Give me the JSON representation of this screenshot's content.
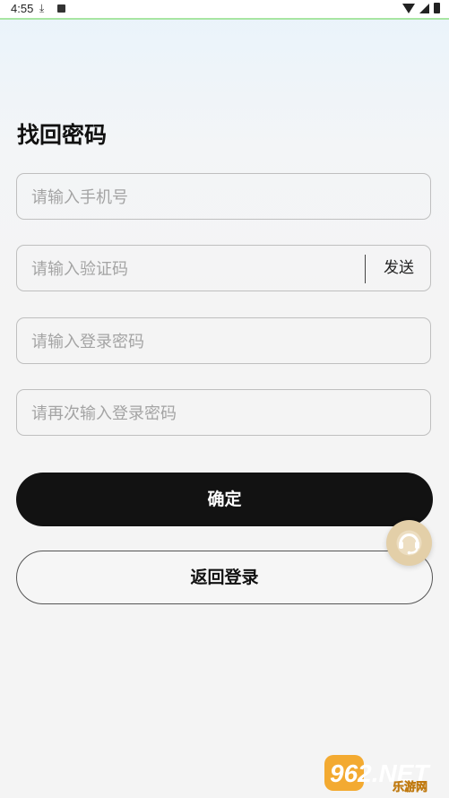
{
  "status_bar": {
    "time": "4:55"
  },
  "page": {
    "title": "找回密码"
  },
  "form": {
    "phone_placeholder": "请输入手机号",
    "code_placeholder": "请输入验证码",
    "send_label": "发送",
    "password_placeholder": "请输入登录密码",
    "confirm_placeholder": "请再次输入登录密码"
  },
  "buttons": {
    "confirm_label": "确定",
    "back_label": "返回登录"
  },
  "watermark": {
    "brand": "962.NET",
    "sub": "乐游网"
  },
  "colors": {
    "primary_button": "#121212",
    "service_button": "#e3cfa8",
    "field_border": "#bfbfbf"
  },
  "icons": {
    "service": "customer-service-headset-icon"
  }
}
